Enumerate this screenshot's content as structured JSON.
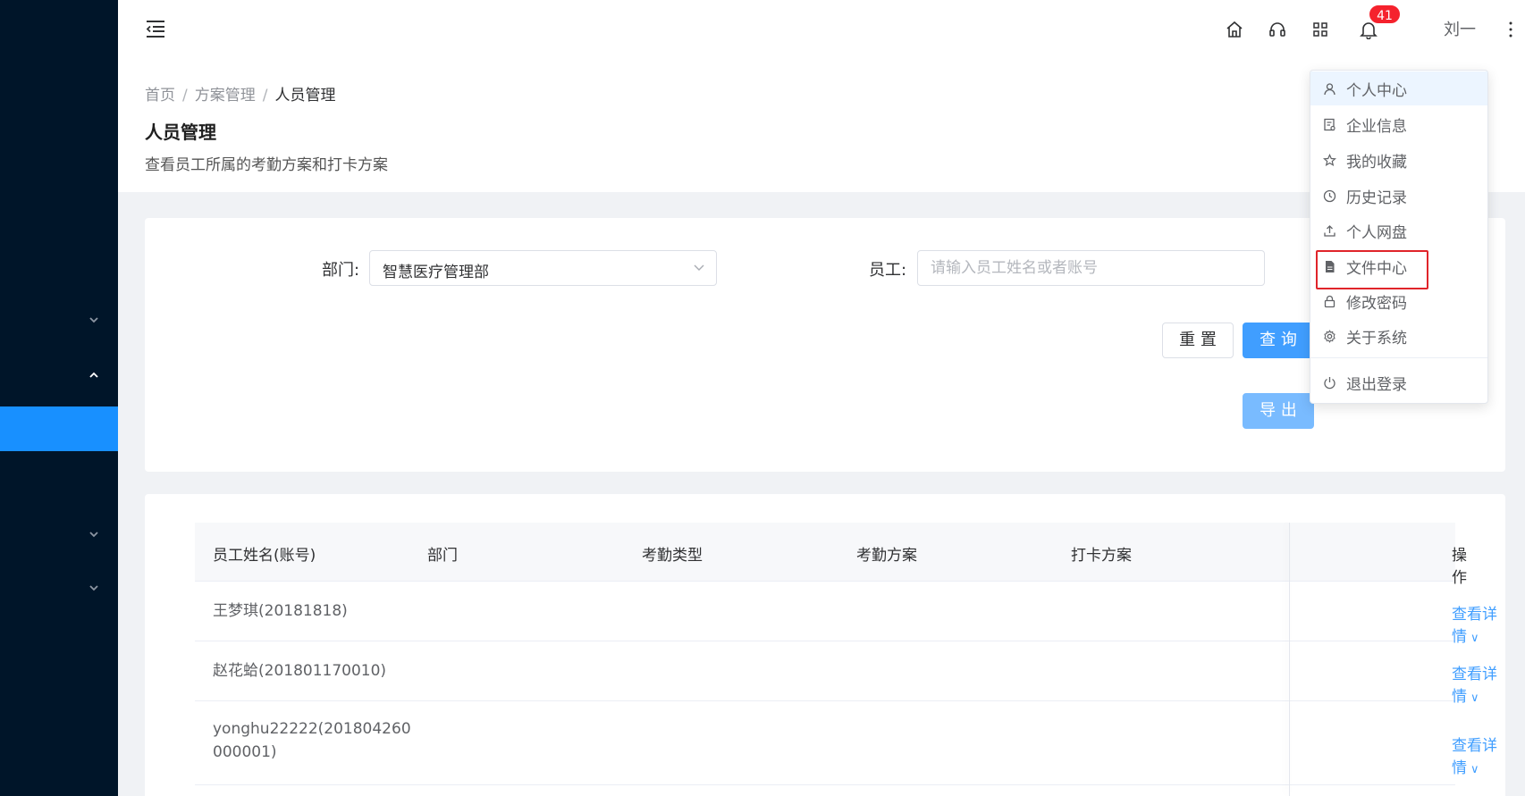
{
  "header": {
    "notification_count": "41",
    "username": "刘一"
  },
  "breadcrumb": {
    "items": [
      "首页",
      "方案管理",
      "人员管理"
    ],
    "separator": "/"
  },
  "page": {
    "title": "人员管理",
    "description": "查看员工所属的考勤方案和打卡方案"
  },
  "filter": {
    "department_label": "部门:",
    "department_value": "智慧医疗管理部",
    "employee_label": "员工:",
    "employee_placeholder": "请输入员工姓名或者账号",
    "employee_value": "",
    "reset_label": "重 置",
    "query_label": "查 询",
    "export_label": "导 出"
  },
  "table": {
    "columns": [
      "员工姓名(账号)",
      "部门",
      "考勤类型",
      "考勤方案",
      "打卡方案",
      "操作"
    ],
    "rows": [
      {
        "name": "王梦琪(20181818)",
        "dept": "",
        "type": "",
        "plan": "",
        "clock": "",
        "action": "查看详情"
      },
      {
        "name": "赵花蛤(201801170010)",
        "dept": "",
        "type": "",
        "plan": "",
        "clock": "",
        "action": "查看详情"
      },
      {
        "name": "yonghu22222(201804260000001)",
        "name_line1": "yonghu22222(201804260",
        "name_line2": "000001)",
        "dept": "",
        "type": "",
        "plan": "",
        "clock": "",
        "action": "查看详情"
      }
    ],
    "action_arrow": "∨"
  },
  "dropdown": {
    "items": [
      {
        "label": "个人中心",
        "icon": "user-icon"
      },
      {
        "label": "企业信息",
        "icon": "company-icon"
      },
      {
        "label": "我的收藏",
        "icon": "star-icon"
      },
      {
        "label": "历史记录",
        "icon": "clock-icon"
      },
      {
        "label": "个人网盘",
        "icon": "upload-icon"
      },
      {
        "label": "文件中心",
        "icon": "document-icon"
      },
      {
        "label": "修改密码",
        "icon": "lock-icon"
      },
      {
        "label": "关于系统",
        "icon": "gear-icon"
      },
      {
        "label": "退出登录",
        "icon": "power-icon"
      }
    ],
    "highlighted_item": "文件中心",
    "highlight_color": "#e0242a"
  },
  "colors": {
    "sidebar": "#001529",
    "sidebar_active": "#1890ff",
    "primary": "#409eff"
  }
}
